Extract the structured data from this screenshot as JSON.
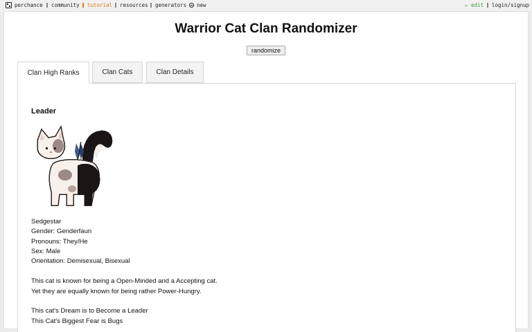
{
  "topnav": {
    "brand": "perchance",
    "community": "community",
    "tutorial": "tutorial",
    "resources": "resources",
    "generators": "generators",
    "new": "new",
    "edit": "✏ edit",
    "login": "login/signup"
  },
  "page": {
    "title": "Warrior Cat Clan Randomizer",
    "randomize_label": "randomize"
  },
  "tabs": [
    {
      "label": "Clan High Ranks",
      "active": true
    },
    {
      "label": "Clan Cats",
      "active": false
    },
    {
      "label": "Clan Details",
      "active": false
    }
  ],
  "leader": {
    "heading": "Leader",
    "name": "Sedgestar",
    "gender": "Gender: Genderfaun",
    "pronouns": "Pronouns: They/He",
    "sex": "Sex: Male",
    "orientation": "Orientation: Demisexual, Bisexual",
    "known_for": "This cat is known for being a Open-Minded and a Accepting cat.",
    "also_known": "Yet they are equally known for being rather Power-Hungry.",
    "dream": "This cat's Dream is to Become a Leader",
    "fear": "This Cat's Biggest Fear is Bugs"
  },
  "colors": {
    "accent_orange": "#e07b17",
    "edit_green": "#3a9a3a"
  }
}
